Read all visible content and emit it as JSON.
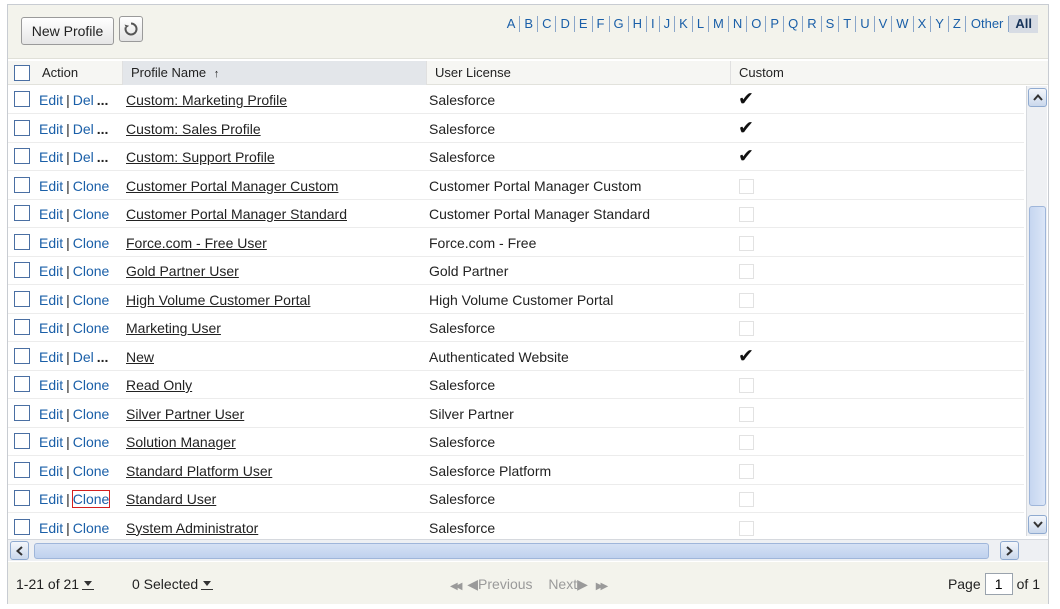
{
  "toolbar": {
    "new_profile_label": "New Profile",
    "refresh_icon": "refresh-icon",
    "letters": [
      "A",
      "B",
      "C",
      "D",
      "E",
      "F",
      "G",
      "H",
      "I",
      "J",
      "K",
      "L",
      "M",
      "N",
      "O",
      "P",
      "Q",
      "R",
      "S",
      "T",
      "U",
      "V",
      "W",
      "X",
      "Y",
      "Z",
      "Other"
    ],
    "all_label": "All"
  },
  "columns": {
    "action": "Action",
    "profile_name": "Profile Name",
    "sort_indicator": "↑",
    "user_license": "User License",
    "custom": "Custom"
  },
  "actions": {
    "edit": "Edit",
    "sep": "|",
    "del": "Del",
    "del_suffix": "...",
    "clone": "Clone"
  },
  "rows": [
    {
      "name": "Custom: Marketing Profile",
      "license": "Salesforce",
      "custom": true
    },
    {
      "name": "Custom: Sales Profile",
      "license": "Salesforce",
      "custom": true
    },
    {
      "name": "Custom: Support Profile",
      "license": "Salesforce",
      "custom": true
    },
    {
      "name": "Customer Portal Manager Custom",
      "license": "Customer Portal Manager Custom",
      "custom": false
    },
    {
      "name": "Customer Portal Manager Standard",
      "license": "Customer Portal Manager Standard",
      "custom": false
    },
    {
      "name": "Force.com - Free User",
      "license": "Force.com - Free",
      "custom": false
    },
    {
      "name": "Gold Partner User",
      "license": "Gold Partner",
      "custom": false
    },
    {
      "name": "High Volume Customer Portal",
      "license": "High Volume Customer Portal",
      "custom": false
    },
    {
      "name": "Marketing User",
      "license": "Salesforce",
      "custom": false
    },
    {
      "name": "New",
      "license": "Authenticated Website",
      "custom": true
    },
    {
      "name": "Read Only",
      "license": "Salesforce",
      "custom": false
    },
    {
      "name": "Silver Partner User",
      "license": "Silver Partner",
      "custom": false
    },
    {
      "name": "Solution Manager",
      "license": "Salesforce",
      "custom": false
    },
    {
      "name": "Standard Platform User",
      "license": "Salesforce Platform",
      "custom": false
    },
    {
      "name": "Standard User",
      "license": "Salesforce",
      "custom": false,
      "highlight_clone": true
    },
    {
      "name": "System Administrator",
      "license": "Salesforce",
      "custom": false
    }
  ],
  "footer": {
    "record_range": "1-21 of 21",
    "selected": "0 Selected",
    "first_icon": "◀◀",
    "previous_label": "◀Previous",
    "next_label": "Next▶",
    "last_icon": "▶▶",
    "page_label": "Page",
    "page_value": "1",
    "of_pages": "of 1"
  },
  "colors": {
    "link": "#1a5fa8",
    "highlight": "#d42020"
  }
}
